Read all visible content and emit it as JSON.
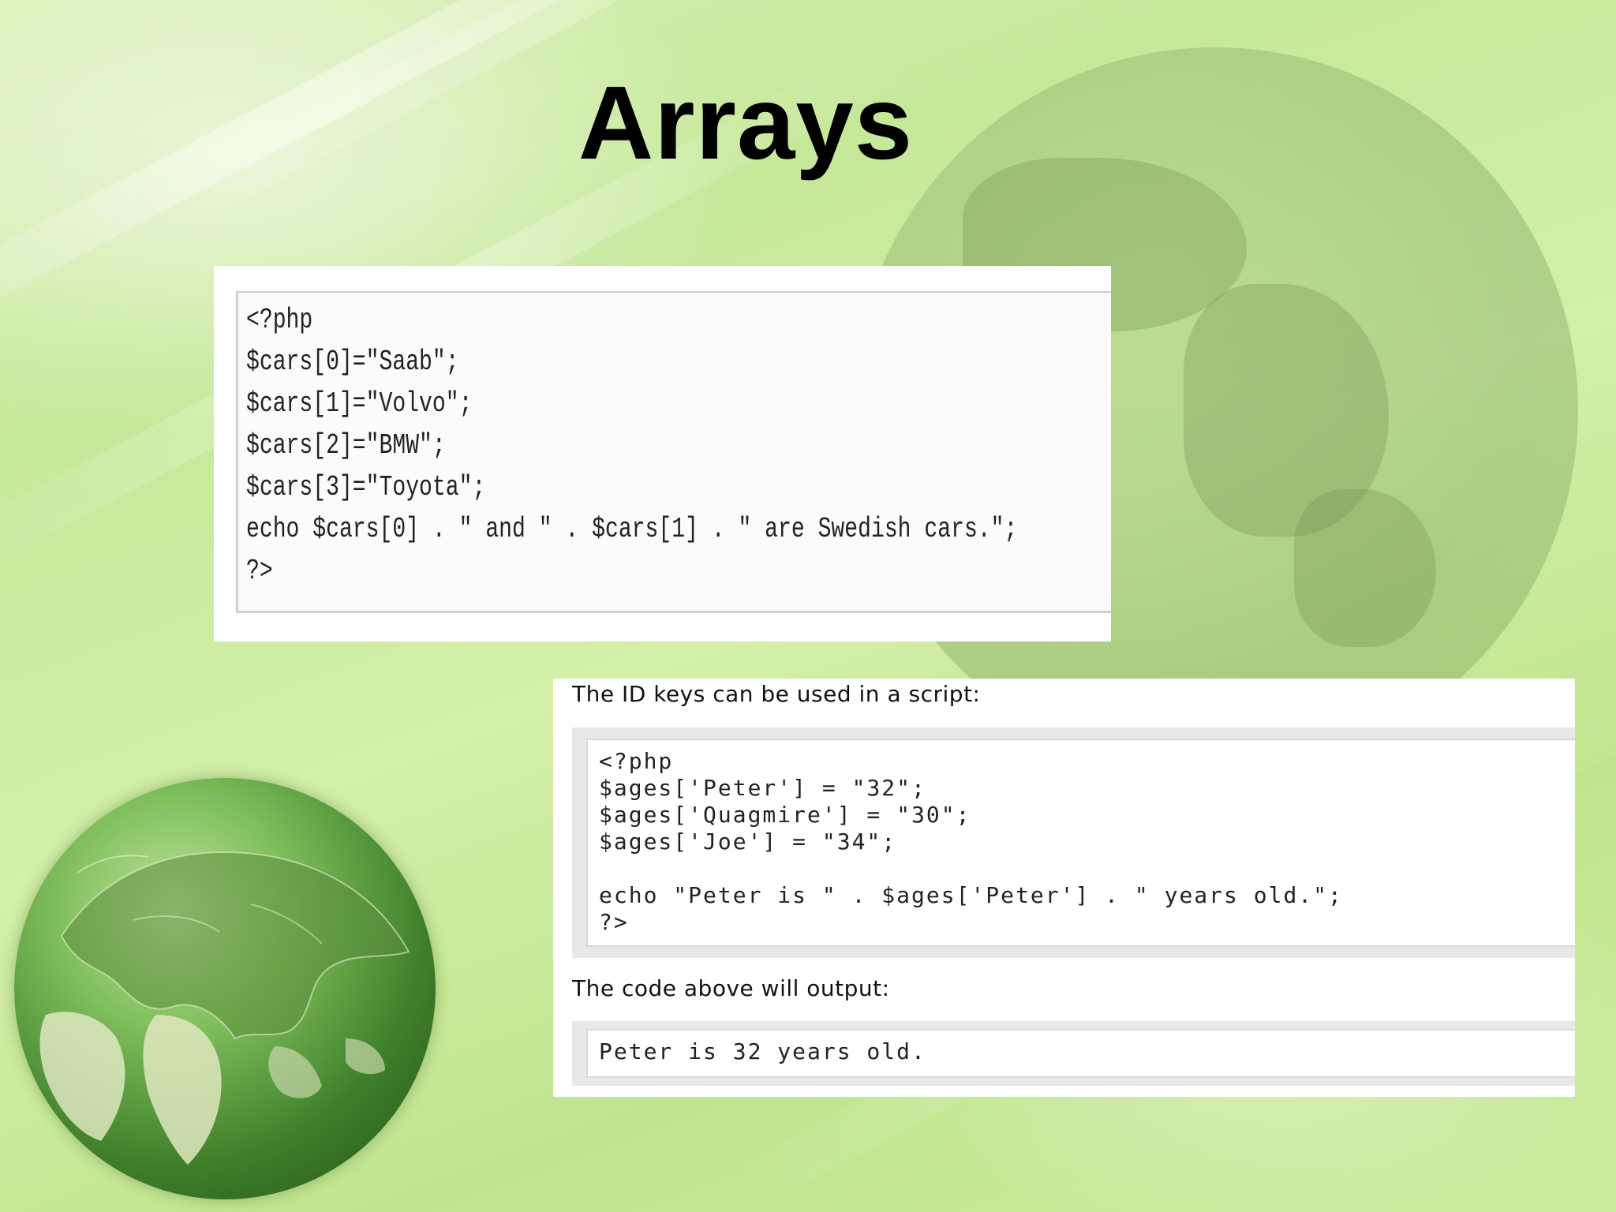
{
  "slide": {
    "title": "Arrays"
  },
  "code_block_1": {
    "lines": [
      "<?php",
      "$cars[0]=\"Saab\";",
      "$cars[1]=\"Volvo\";",
      "$cars[2]=\"BMW\";",
      "$cars[3]=\"Toyota\";",
      "echo $cars[0] . \" and \" . $cars[1] . \" are Swedish cars.\";",
      "?>"
    ]
  },
  "code_block_2": {
    "heading": "The ID keys can be used in a script:",
    "lines": [
      "<?php",
      "$ages['Peter'] = \"32\";",
      "$ages['Quagmire'] = \"30\";",
      "$ages['Joe'] = \"34\";",
      "",
      "echo \"Peter is \" . $ages['Peter'] . \" years old.\";",
      "?>"
    ],
    "output_heading": "The code above will output:",
    "output": "Peter is 32 years old."
  },
  "colors": {
    "background": "#cdeb9e",
    "title": "#000000",
    "panel": "#ffffff"
  },
  "icons": [
    "globe-image",
    "background-globe-image"
  ]
}
